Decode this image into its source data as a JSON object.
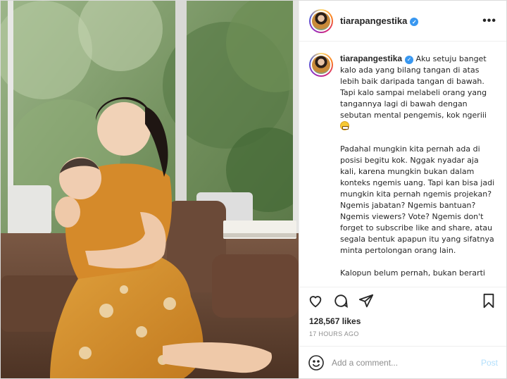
{
  "post": {
    "username": "tiarapangestika",
    "verified": true,
    "more_label": "•••"
  },
  "caption": {
    "username": "tiarapangestika",
    "paragraph1": "Aku setuju banget kalo ada yang bilang tangan di atas lebih baik daripada tangan di bawah. Tapi kalo sampai melabeli orang yang tangannya lagi di bawah dengan sebutan mental pengemis, kok ngeriii",
    "paragraph2": "Padahal mungkin kita pernah ada di posisi begitu kok. Nggak nyadar aja kali, karena mungkin bukan dalam konteks ngemis uang. Tapi kan bisa jadi mungkin kita pernah ngemis projekan? Ngemis jabatan? Ngemis bantuan? Ngemis viewers? Vote? Ngemis don't forget to subscribe like and share, atau segala bentuk apapun itu yang sifatnya minta pertolongan orang lain.",
    "paragraph3": "Kalopun belum pernah, bukan berarti",
    "emoji": "grimacing-face-emoji"
  },
  "actions": {
    "like_icon": "heart-icon",
    "comment_icon": "comment-icon",
    "share_icon": "paper-plane-icon",
    "save_icon": "bookmark-icon"
  },
  "likes_text": "128,567 likes",
  "timestamp": "17 HOURS AGO",
  "comment": {
    "placeholder": "Add a comment...",
    "post_label": "Post",
    "emoji_icon": "smiley-icon"
  },
  "colors": {
    "verified_blue": "#3897f0",
    "post_button_inactive": "#b2dffc",
    "dress_mustard": "#d58a2a"
  }
}
